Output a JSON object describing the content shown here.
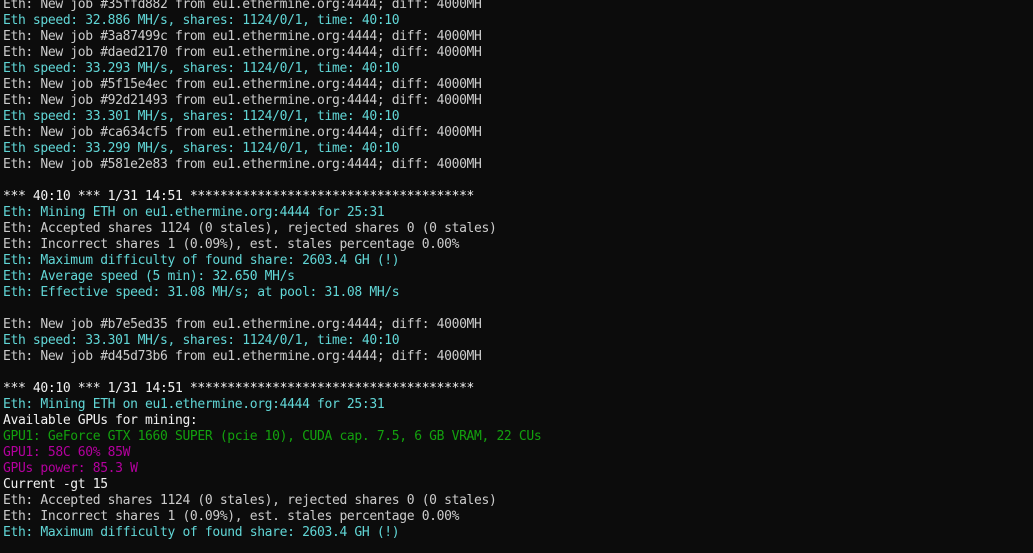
{
  "colors": {
    "background": "#0c0c0c",
    "default": "#cccccc",
    "speed": "#3a96dd",
    "gpu_info": "#13a10e",
    "gpu_stats": "#b4009e"
  },
  "lines": [
    {
      "text": "Eth: New job #35ffd882 from eu1.ethermine.org:4444; diff: 4000MH",
      "color": "white"
    },
    {
      "text": "Eth speed: 32.886 MH/s, shares: 1124/0/1, time: 40:10",
      "color": "cyan"
    },
    {
      "text": "Eth: New job #3a87499c from eu1.ethermine.org:4444; diff: 4000MH",
      "color": "white"
    },
    {
      "text": "Eth: New job #daed2170 from eu1.ethermine.org:4444; diff: 4000MH",
      "color": "white"
    },
    {
      "text": "Eth speed: 33.293 MH/s, shares: 1124/0/1, time: 40:10",
      "color": "cyan"
    },
    {
      "text": "Eth: New job #5f15e4ec from eu1.ethermine.org:4444; diff: 4000MH",
      "color": "white"
    },
    {
      "text": "Eth: New job #92d21493 from eu1.ethermine.org:4444; diff: 4000MH",
      "color": "white"
    },
    {
      "text": "Eth speed: 33.301 MH/s, shares: 1124/0/1, time: 40:10",
      "color": "cyan"
    },
    {
      "text": "Eth: New job #ca634cf5 from eu1.ethermine.org:4444; diff: 4000MH",
      "color": "white"
    },
    {
      "text": "Eth speed: 33.299 MH/s, shares: 1124/0/1, time: 40:10",
      "color": "cyan"
    },
    {
      "text": "Eth: New job #581e2e83 from eu1.ethermine.org:4444; diff: 4000MH",
      "color": "white"
    },
    {
      "text": "",
      "color": "white"
    },
    {
      "text": "*** 40:10 *** 1/31 14:51 **************************************",
      "color": "bright"
    },
    {
      "text": "Eth: Mining ETH on eu1.ethermine.org:4444 for 25:31",
      "color": "cyan"
    },
    {
      "text": "Eth: Accepted shares 1124 (0 stales), rejected shares 0 (0 stales)",
      "color": "white"
    },
    {
      "text": "Eth: Incorrect shares 1 (0.09%), est. stales percentage 0.00%",
      "color": "white"
    },
    {
      "text": "Eth: Maximum difficulty of found share: 2603.4 GH (!)",
      "color": "cyan"
    },
    {
      "text": "Eth: Average speed (5 min): 32.650 MH/s",
      "color": "cyan"
    },
    {
      "text": "Eth: Effective speed: 31.08 MH/s; at pool: 31.08 MH/s",
      "color": "cyan"
    },
    {
      "text": "",
      "color": "white"
    },
    {
      "text": "Eth: New job #b7e5ed35 from eu1.ethermine.org:4444; diff: 4000MH",
      "color": "white"
    },
    {
      "text": "Eth speed: 33.301 MH/s, shares: 1124/0/1, time: 40:10",
      "color": "cyan"
    },
    {
      "text": "Eth: New job #d45d73b6 from eu1.ethermine.org:4444; diff: 4000MH",
      "color": "white"
    },
    {
      "text": "",
      "color": "white"
    },
    {
      "text": "*** 40:10 *** 1/31 14:51 **************************************",
      "color": "bright"
    },
    {
      "text": "Eth: Mining ETH on eu1.ethermine.org:4444 for 25:31",
      "color": "cyan"
    },
    {
      "text": "Available GPUs for mining:",
      "color": "bright"
    },
    {
      "text": "GPU1: GeForce GTX 1660 SUPER (pcie 10), CUDA cap. 7.5, 6 GB VRAM, 22 CUs",
      "color": "green"
    },
    {
      "text": "GPU1: 58C 60% 85W",
      "color": "magenta"
    },
    {
      "text": "GPUs power: 85.3 W",
      "color": "magenta"
    },
    {
      "text": "Current -gt 15",
      "color": "bright"
    },
    {
      "text": "Eth: Accepted shares 1124 (0 stales), rejected shares 0 (0 stales)",
      "color": "white"
    },
    {
      "text": "Eth: Incorrect shares 1 (0.09%), est. stales percentage 0.00%",
      "color": "white"
    },
    {
      "text": "Eth: Maximum difficulty of found share: 2603.4 GH (!)",
      "color": "cyan"
    }
  ]
}
